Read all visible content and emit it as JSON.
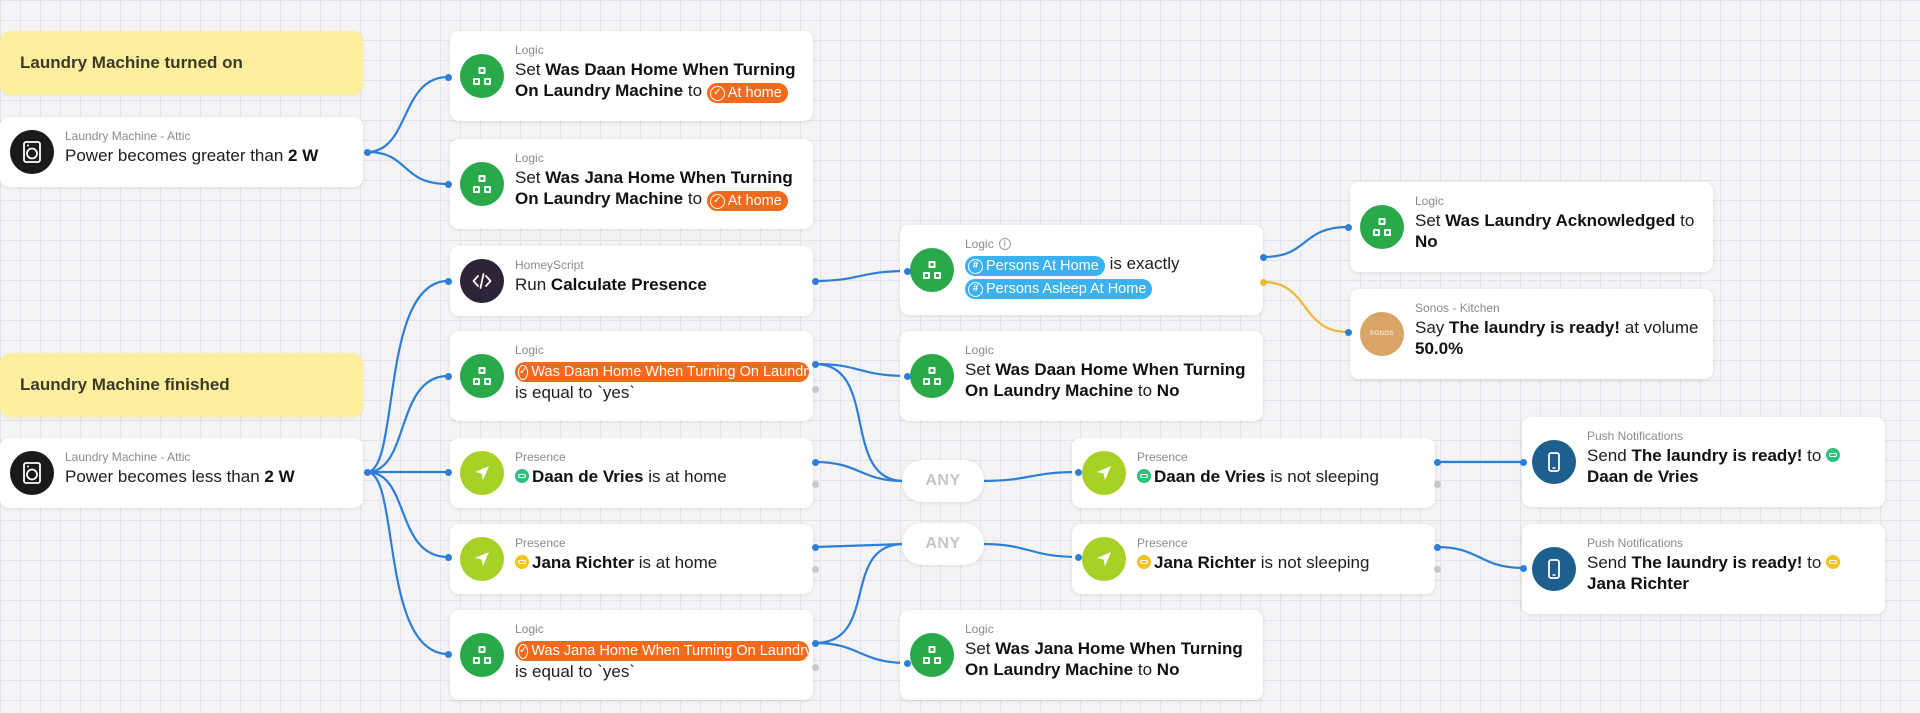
{
  "colors": {
    "wire": "#2d7fd6",
    "wire_else": "#f0b630",
    "logic_green": "#2aa94a",
    "presence_lime": "#a7d127",
    "script_dark": "#2d2438",
    "push_blue": "#1e5f8e",
    "sonos_tan": "#d9a566",
    "tag_orange": "#f26a1b",
    "tag_blue": "#3bb2f0",
    "note_yellow": "#fcef9d"
  },
  "notes": {
    "n1": "Laundry Machine turned on",
    "n2": "Laundry Machine finished"
  },
  "cards": {
    "trigger_on": {
      "icon": "washing-machine-icon",
      "source": "Laundry Machine - Attic",
      "t1": "Power becomes greater than",
      "b1": "2 W"
    },
    "set_daan_home": {
      "icon": "logic-icon",
      "source": "Logic",
      "t1": "Set",
      "b1": "Was Daan Home When Turning On Laundry Machine",
      "t2": "to",
      "tag": "At home"
    },
    "set_jana_home": {
      "icon": "logic-icon",
      "source": "Logic",
      "t1": "Set",
      "b1": "Was Jana Home When Turning On Laundry Machine",
      "t2": "to",
      "tag": "At home"
    },
    "run_script": {
      "icon": "code-icon",
      "source": "HomeyScript",
      "t1": "Run",
      "b1": "Calculate Presence"
    },
    "cond_persons": {
      "icon": "logic-icon",
      "source": "Logic",
      "tag1": "Persons At Home",
      "t1": "is exactly",
      "tag2": "Persons Asleep At Home"
    },
    "set_ack": {
      "icon": "logic-icon",
      "source": "Logic",
      "t1": "Set",
      "b1": "Was Laundry Acknowledged",
      "t2": "to",
      "b2": "No"
    },
    "sonos_say": {
      "icon": "sonos-icon",
      "icon_text": "SONOS",
      "source": "Sonos - Kitchen",
      "t1": "Say",
      "b1": "The laundry is ready!",
      "t2": "at volume",
      "b2": "50.0%"
    },
    "cond_daan_was_home": {
      "icon": "logic-icon",
      "source": "Logic",
      "tag": "Was Daan Home When Turning On Laundry Machine",
      "t1": "is equal to `yes`"
    },
    "set_daan_no": {
      "icon": "logic-icon",
      "source": "Logic",
      "t1": "Set",
      "b1": "Was Daan Home When Turning On Laundry Machine",
      "t2": "to",
      "b2": "No"
    },
    "trigger_off": {
      "icon": "washing-machine-icon",
      "source": "Laundry Machine - Attic",
      "t1": "Power becomes less than",
      "b1": "2 W"
    },
    "daan_home": {
      "icon": "location-arrow-icon",
      "source": "Presence",
      "b1": "Daan de Vries",
      "t1": "is at home"
    },
    "any1": "ANY",
    "daan_not_sleeping": {
      "icon": "location-arrow-icon",
      "source": "Presence",
      "b1": "Daan de Vries",
      "t1": "is not sleeping"
    },
    "push_daan": {
      "icon": "phone-icon",
      "source": "Push Notifications",
      "t1": "Send",
      "b1": "The laundry is ready!",
      "t2": "to",
      "b2": "Daan de Vries"
    },
    "jana_home": {
      "icon": "location-arrow-icon",
      "source": "Presence",
      "b1": "Jana Richter",
      "t1": "is at home"
    },
    "any2": "ANY",
    "jana_not_sleeping": {
      "icon": "location-arrow-icon",
      "source": "Presence",
      "b1": "Jana Richter",
      "t1": "is not sleeping"
    },
    "push_jana": {
      "icon": "phone-icon",
      "source": "Push Notifications",
      "t1": "Send",
      "b1": "The laundry is ready!",
      "t2": "to",
      "b2": "Jana Richter"
    },
    "cond_jana_was_home": {
      "icon": "logic-icon",
      "source": "Logic",
      "tag": "Was Jana Home When Turning On Laundry Machine",
      "t1": "is equal to `yes`"
    },
    "set_jana_no": {
      "icon": "logic-icon",
      "source": "Logic",
      "t1": "Set",
      "b1": "Was Jana Home When Turning On Laundry Machine",
      "t2": "to",
      "b2": "No"
    }
  }
}
